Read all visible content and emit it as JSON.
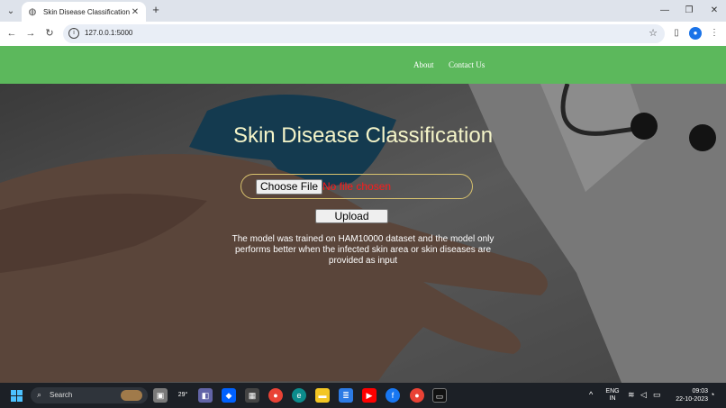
{
  "browser": {
    "tab_title": "Skin Disease Classification",
    "url": "127.0.0.1:5000"
  },
  "navbar": {
    "links": [
      "About",
      "Contact Us"
    ],
    "color": "#5cb85c"
  },
  "main": {
    "heading": "Skin Disease Classification",
    "choose_file_label": "Choose File",
    "no_file_text": "No file chosen",
    "upload_label": "Upload",
    "description": "The model was trained on HAM10000 dataset and the model only performs better when the infected skin area or skin diseases are provided as input"
  },
  "taskbar": {
    "search_label": "Search",
    "weather_temp": "29°",
    "lang_line1": "ENG",
    "lang_line2": "IN",
    "time": "09:03",
    "date": "22-10-2023"
  }
}
